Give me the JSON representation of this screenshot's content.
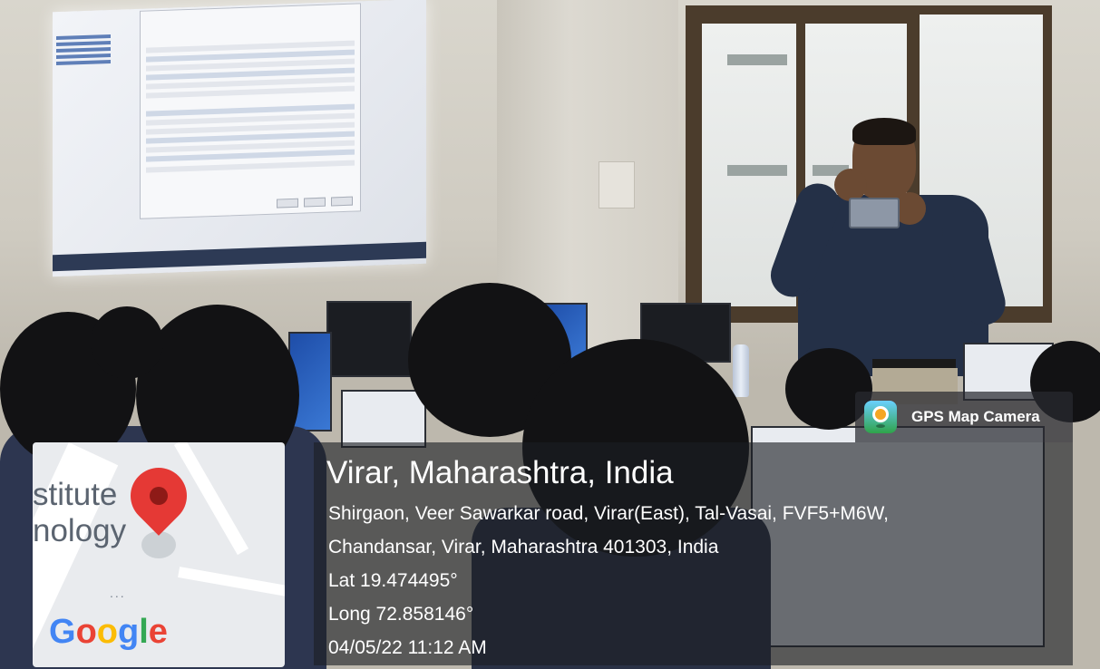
{
  "gps_badge": {
    "app_name": "GPS Map Camera",
    "icon": "gps-map-camera-app-icon"
  },
  "location": {
    "title": "Virar, Maharashtra, India",
    "address_line1": "Shirgaon, Veer Sawarkar road, Virar(East), Tal-Vasai, FVF5+M6W,",
    "address_line2": "Chandansar, Virar, Maharashtra 401303, India",
    "latitude": "Lat 19.474495°",
    "longitude": "Long 72.858146°",
    "datetime": "04/05/22 11:12 AM"
  },
  "map": {
    "label_line1": "stitute",
    "label_line2": "nology",
    "overflow_dots": "...",
    "pin_icon": "map-pin-icon",
    "logo": [
      "G",
      "o",
      "o",
      "g",
      "l",
      "e"
    ]
  },
  "colors": {
    "pin": "#e53935",
    "overlay": "#1c1e24"
  }
}
